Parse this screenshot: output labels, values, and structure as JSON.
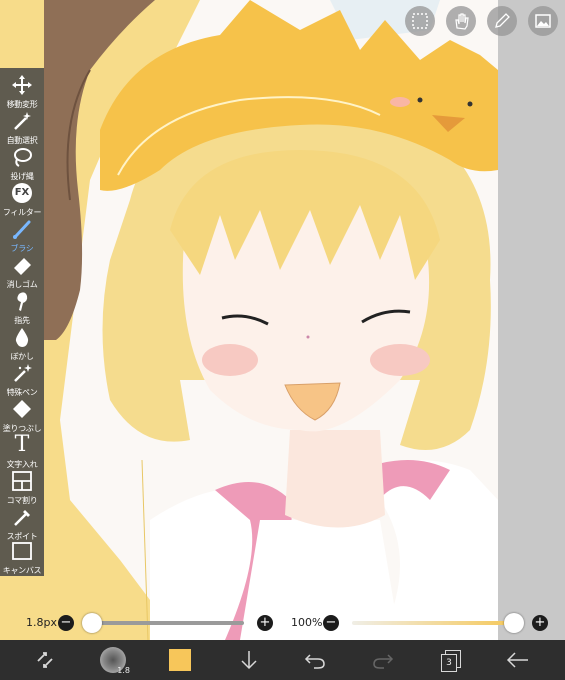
{
  "canvas": {
    "colors": {
      "background": "#fbf8f5",
      "hair": "#f5dc8e",
      "crown": "#f6c24a",
      "left_bg": "#f7dc8a",
      "brown": "#8f6f56",
      "hoodie": "#ee9bb8",
      "skin": "#fdf1ea",
      "blush": "#f7c9c2"
    }
  },
  "toolbar": {
    "items": [
      {
        "name": "move-transform",
        "label": "移動変形",
        "icon": "move-icon"
      },
      {
        "name": "auto-select",
        "label": "自動選択",
        "icon": "magic-wand-icon"
      },
      {
        "name": "lasso",
        "label": "投げ縄",
        "icon": "lasso-icon"
      },
      {
        "name": "filter",
        "label": "フィルター",
        "icon": "fx-icon",
        "icon_text": "FX"
      },
      {
        "name": "brush",
        "label": "ブラシ",
        "icon": "brush-icon",
        "active": true
      },
      {
        "name": "eraser",
        "label": "消しゴム",
        "icon": "eraser-icon"
      },
      {
        "name": "smudge",
        "label": "指先",
        "icon": "finger-icon"
      },
      {
        "name": "blur",
        "label": "ぼかし",
        "icon": "drop-icon"
      },
      {
        "name": "special-pen",
        "label": "特殊ペン",
        "icon": "sparkle-pen-icon"
      },
      {
        "name": "fill",
        "label": "塗りつぶし",
        "icon": "bucket-icon"
      },
      {
        "name": "text",
        "label": "文字入れ",
        "icon": "text-icon",
        "icon_text": "T"
      },
      {
        "name": "frame-divider",
        "label": "コマ割り",
        "icon": "frame-icon"
      },
      {
        "name": "eyedropper",
        "label": "スポイト",
        "icon": "eyedropper-icon"
      },
      {
        "name": "canvas",
        "label": "キャンバス",
        "icon": "canvas-icon"
      }
    ]
  },
  "top_buttons": [
    {
      "name": "selection",
      "icon": "selection-icon"
    },
    {
      "name": "hand",
      "icon": "hand-icon"
    },
    {
      "name": "pen-setting",
      "icon": "pen-icon"
    },
    {
      "name": "image",
      "icon": "image-icon"
    }
  ],
  "sliders": {
    "brush_size": {
      "value_label": "1.8px",
      "level": 0.0
    },
    "opacity": {
      "value_label": "100%",
      "level": 1.0
    },
    "minus": "−",
    "plus": "+"
  },
  "bottom_bar": {
    "brush_preview_label": "1.8",
    "current_color": "#f7c65a",
    "layer_count": "3",
    "colors": {
      "bar": "#2e2e2e",
      "icon": "#d8d8d8",
      "icon_disabled": "#666666"
    }
  }
}
